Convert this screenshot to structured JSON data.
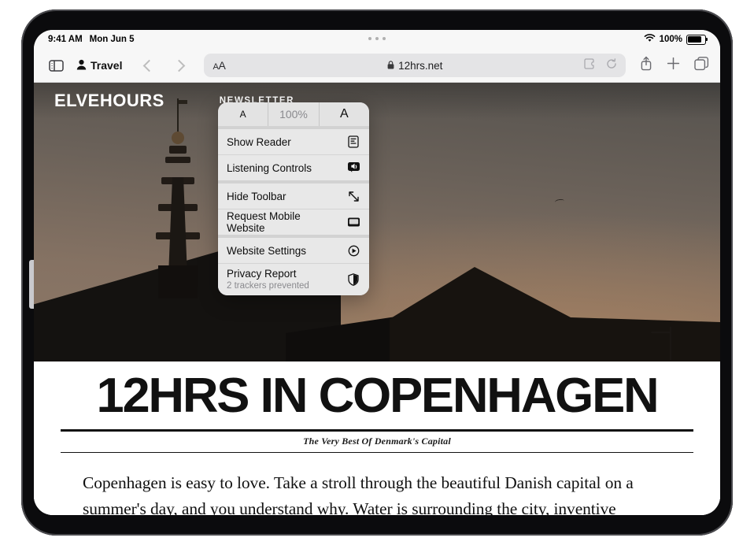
{
  "status_bar": {
    "time": "9:41 AM",
    "date": "Mon Jun 5",
    "battery_percent": "100%",
    "wifi_icon": "wifi-icon",
    "battery_icon": "battery-icon"
  },
  "toolbar": {
    "sidebar_icon": "sidebar-toggle-icon",
    "profile_label": "Travel",
    "profile_icon": "person-icon",
    "back_icon": "chevron-left-icon",
    "forward_icon": "chevron-right-icon",
    "aa_label": "AA",
    "lock_icon": "lock-icon",
    "url": "12hrs.net",
    "extensions_icon": "extensions-puzzle-icon",
    "reload_icon": "reload-icon",
    "share_icon": "share-icon",
    "new_tab_label": "+",
    "tabs_icon": "tab-overview-icon"
  },
  "popover": {
    "zoom_out_label": "A",
    "zoom_level": "100%",
    "zoom_in_label": "A",
    "items": [
      {
        "label": "Show Reader",
        "icon": "reader-icon"
      },
      {
        "label": "Listening Controls",
        "icon": "listening-controls-icon"
      },
      {
        "label": "Hide Toolbar",
        "icon": "expand-arrows-icon"
      },
      {
        "label": "Request Mobile Website",
        "icon": "monitor-icon"
      },
      {
        "label": "Website Settings",
        "icon": "website-settings-icon"
      },
      {
        "label": "Privacy Report",
        "sub": "2 trackers prevented",
        "icon": "privacy-shield-icon"
      }
    ]
  },
  "website": {
    "logo": "ELVEHOURS",
    "nav_newsletter": "NEWSLETTER",
    "headline": "12HRS IN COPENHAGEN",
    "subtitle": "The Very Best Of Denmark's Capital",
    "body": "Copenhagen is easy to love. Take a stroll through the beautiful Danish capital on a summer's day, and you understand why. Water is surrounding the city, inventive architecture and"
  }
}
